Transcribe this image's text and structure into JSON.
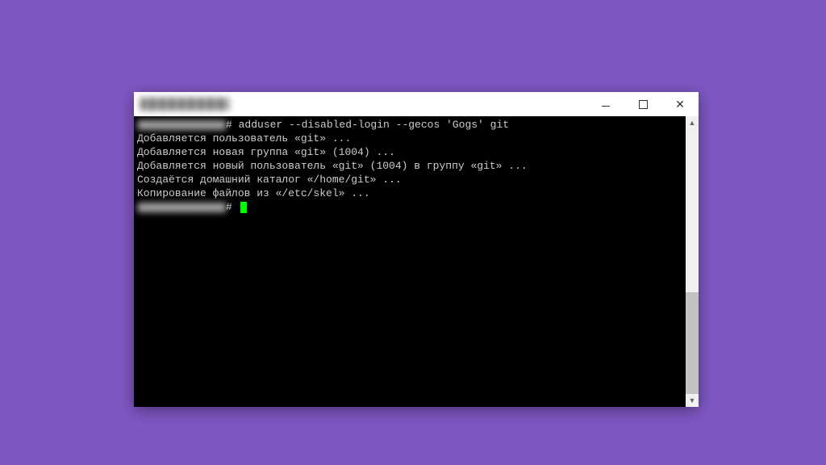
{
  "terminal": {
    "prompt_suffix_1": "# ",
    "command": "adduser --disabled-login --gecos 'Gogs' git",
    "lines": [
      "Добавляется пользователь «git» ...",
      "Добавляется новая группа «git» (1004) ...",
      "Добавляется новый пользователь «git» (1004) в группу «git» ...",
      "Создаётся домашний каталог «/home/git» ...",
      "Копирование файлов из «/etc/skel» ..."
    ],
    "prompt_suffix_2": "# "
  }
}
